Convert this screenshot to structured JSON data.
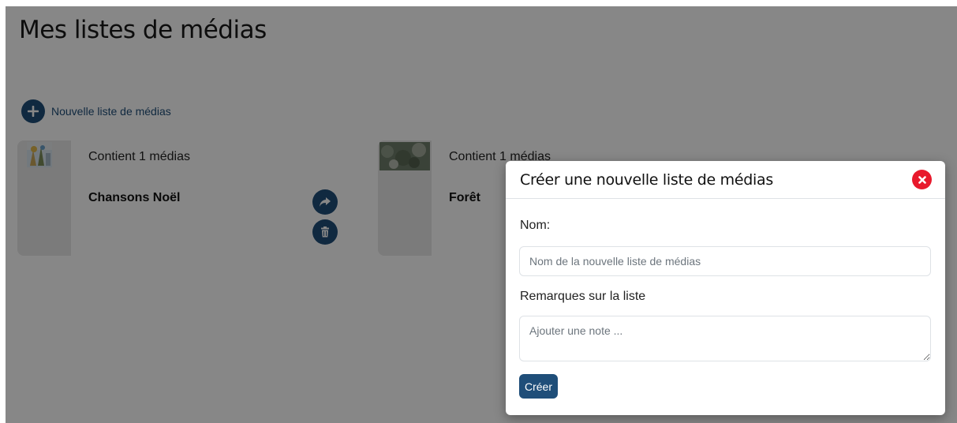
{
  "page": {
    "title": "Mes listes de médias",
    "new_list_label": "Nouvelle liste de médias"
  },
  "lists": [
    {
      "count": "Contient 1 médias",
      "name": "Chansons Noël"
    },
    {
      "count": "Contient 1 médias",
      "name": "Forêt"
    }
  ],
  "modal": {
    "title": "Créer une nouvelle liste de médias",
    "name_label": "Nom:",
    "name_placeholder": "Nom de la nouvelle liste de médias",
    "remarks_label": "Remarques sur la liste",
    "remarks_placeholder": "Ajouter une note ...",
    "create_label": "Créer"
  },
  "colors": {
    "accent": "#1f4e79",
    "close": "#e8192c",
    "overlay": "rgba(0,0,0,0.47)"
  },
  "icons": [
    "plus-icon",
    "share-icon",
    "trash-icon",
    "close-icon"
  ]
}
